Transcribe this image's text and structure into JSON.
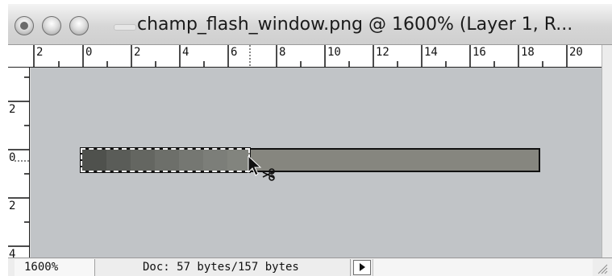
{
  "window": {
    "title": "champ_flash_window.png @ 1600% (Layer 1, R..."
  },
  "ruler": {
    "horizontal_labels": [
      "2",
      "0",
      "2",
      "4",
      "6",
      "8",
      "10",
      "12",
      "14",
      "16",
      "18",
      "20"
    ],
    "vertical_labels": [
      "2",
      "0",
      "2",
      "4"
    ]
  },
  "status": {
    "zoom": "1600%",
    "doc_info": "Doc: 57 bytes/157 bytes"
  },
  "canvas": {
    "background": "#c1c4c7",
    "bar_fill": "#86867f",
    "gradient_cells": [
      "#4f514d",
      "#5a5c58",
      "#646661",
      "#6d6f6a",
      "#757772",
      "#7c7e79",
      "#82847e"
    ]
  },
  "icons": {
    "close": "close-window-icon",
    "minimize": "minimize-window-icon",
    "zoom": "zoom-window-icon",
    "cursor": "scissors-cursor-icon",
    "status_menu": "triangle-right-icon",
    "resize": "resize-grip-icon"
  }
}
